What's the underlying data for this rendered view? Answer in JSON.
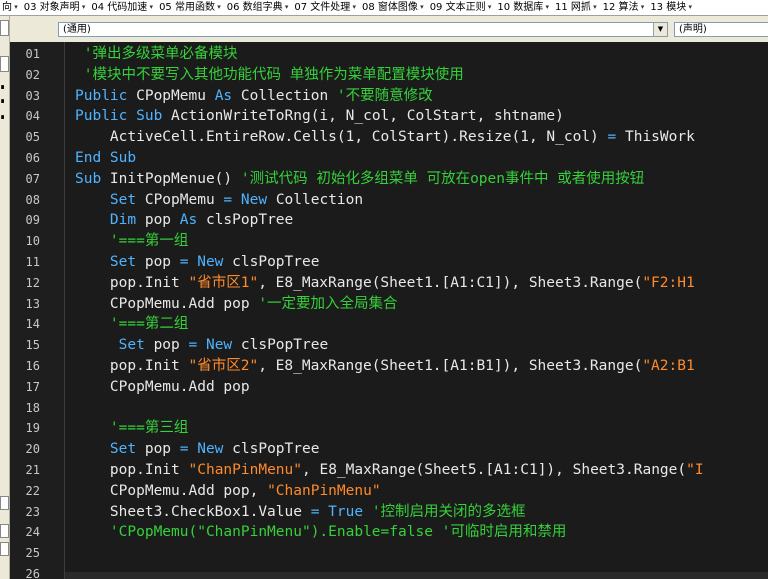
{
  "menubar": {
    "items": [
      {
        "label": "向",
        "arrow": "▾"
      },
      {
        "label": "03 对象声明",
        "arrow": "▾"
      },
      {
        "label": "04 代码加速",
        "arrow": "▾"
      },
      {
        "label": "05 常用函数",
        "arrow": "▾"
      },
      {
        "label": "06 数组字典",
        "arrow": "▾"
      },
      {
        "label": "07 文件处理",
        "arrow": "▾"
      },
      {
        "label": "08 窗体图像",
        "arrow": "▾"
      },
      {
        "label": "09 文本正则",
        "arrow": "▾"
      },
      {
        "label": "10 数据库",
        "arrow": "▾"
      },
      {
        "label": "11 网抓",
        "arrow": "▾"
      },
      {
        "label": "12 算法",
        "arrow": "▾"
      },
      {
        "label": "13 模块",
        "arrow": "▾"
      }
    ]
  },
  "combos": {
    "object": "(通用)",
    "procedure": "(声明)",
    "dropdown_glyph": "▼"
  },
  "editor": {
    "line_numbers": [
      "01",
      "02",
      "03",
      "04",
      "05",
      "06",
      "07",
      "08",
      "09",
      "10",
      "11",
      "12",
      "13",
      "14",
      "15",
      "16",
      "17",
      "18",
      "19",
      "20",
      "21",
      "22",
      "23",
      "24",
      "25",
      "26"
    ],
    "lines": [
      [
        {
          "t": " ",
          "c": ""
        },
        {
          "t": "'弹出多级菜单必备模块",
          "c": "cm"
        }
      ],
      [
        {
          "t": " ",
          "c": ""
        },
        {
          "t": "'模块中不要写入其他功能代码 单独作为菜单配置模块使用",
          "c": "cm"
        }
      ],
      [
        {
          "t": "Public ",
          "c": "kw"
        },
        {
          "t": "CPopMemu ",
          "c": ""
        },
        {
          "t": "As ",
          "c": "kw"
        },
        {
          "t": "Collection ",
          "c": ""
        },
        {
          "t": "'不要随意修改",
          "c": "cm"
        }
      ],
      [
        {
          "t": "Public Sub ",
          "c": "kw"
        },
        {
          "t": "ActionWriteToRng(i, N_col, ColStart, shtname)",
          "c": ""
        }
      ],
      [
        {
          "t": "    ActiveCell.EntireRow.Cells(1, ColStart).Resize(1, N_col) ",
          "c": ""
        },
        {
          "t": "=",
          "c": "op"
        },
        {
          "t": " ThisWork",
          "c": ""
        }
      ],
      [
        {
          "t": "End Sub",
          "c": "kw"
        }
      ],
      [
        {
          "t": "Sub ",
          "c": "kw"
        },
        {
          "t": "InitPopMenue() ",
          "c": ""
        },
        {
          "t": "'测试代码 初始化多组菜单 可放在open事件中 或者使用按钮",
          "c": "cm"
        }
      ],
      [
        {
          "t": "    Set ",
          "c": "kw"
        },
        {
          "t": "CPopMemu ",
          "c": ""
        },
        {
          "t": "= New ",
          "c": "kw"
        },
        {
          "t": "Collection",
          "c": ""
        }
      ],
      [
        {
          "t": "    Dim ",
          "c": "kw"
        },
        {
          "t": "pop ",
          "c": ""
        },
        {
          "t": "As ",
          "c": "kw"
        },
        {
          "t": "clsPopTree",
          "c": ""
        }
      ],
      [
        {
          "t": "    '===第一组",
          "c": "cm"
        }
      ],
      [
        {
          "t": "    Set ",
          "c": "kw"
        },
        {
          "t": "pop ",
          "c": ""
        },
        {
          "t": "= New ",
          "c": "kw"
        },
        {
          "t": "clsPopTree",
          "c": ""
        }
      ],
      [
        {
          "t": "    pop.Init ",
          "c": ""
        },
        {
          "t": "\"省市区1\"",
          "c": "st"
        },
        {
          "t": ", E8_MaxRange(Sheet1.[A1:C1]), Sheet3.Range(",
          "c": ""
        },
        {
          "t": "\"F2:H1",
          "c": "st"
        }
      ],
      [
        {
          "t": "    CPopMemu.Add pop ",
          "c": ""
        },
        {
          "t": "'一定要加入全局集合",
          "c": "cm"
        }
      ],
      [
        {
          "t": "    '===第二组",
          "c": "cm"
        }
      ],
      [
        {
          "t": "     Set ",
          "c": "kw"
        },
        {
          "t": "pop ",
          "c": ""
        },
        {
          "t": "= New ",
          "c": "kw"
        },
        {
          "t": "clsPopTree",
          "c": ""
        }
      ],
      [
        {
          "t": "    pop.Init ",
          "c": ""
        },
        {
          "t": "\"省市区2\"",
          "c": "st"
        },
        {
          "t": ", E8_MaxRange(Sheet1.[A1:B1]), Sheet3.Range(",
          "c": ""
        },
        {
          "t": "\"A2:B1",
          "c": "st"
        }
      ],
      [
        {
          "t": "    CPopMemu.Add pop",
          "c": ""
        }
      ],
      [
        {
          "t": "",
          "c": ""
        }
      ],
      [
        {
          "t": "    '===第三组",
          "c": "cm"
        }
      ],
      [
        {
          "t": "    Set ",
          "c": "kw"
        },
        {
          "t": "pop ",
          "c": ""
        },
        {
          "t": "= New ",
          "c": "kw"
        },
        {
          "t": "clsPopTree",
          "c": ""
        }
      ],
      [
        {
          "t": "    pop.Init ",
          "c": ""
        },
        {
          "t": "\"ChanPinMenu\"",
          "c": "st"
        },
        {
          "t": ", E8_MaxRange(Sheet5.[A1:C1]), Sheet3.Range(",
          "c": ""
        },
        {
          "t": "\"I",
          "c": "st"
        }
      ],
      [
        {
          "t": "    CPopMemu.Add pop, ",
          "c": ""
        },
        {
          "t": "\"ChanPinMenu\"",
          "c": "st"
        }
      ],
      [
        {
          "t": "    Sheet3.CheckBox1.Value ",
          "c": ""
        },
        {
          "t": "= True ",
          "c": "kw"
        },
        {
          "t": "'控制启用关闭的多选框",
          "c": "cm"
        }
      ],
      [
        {
          "t": "    'CPopMemu(\"ChanPinMenu\").Enable=false '可临时启用和禁用",
          "c": "cm"
        }
      ],
      [
        {
          "t": "",
          "c": ""
        }
      ],
      [
        {
          "t": "",
          "c": ""
        }
      ]
    ]
  },
  "colors": {
    "keyword": "#4fb3ff",
    "comment": "#35d13a",
    "string": "#ff8a2b",
    "text": "#e8e8e8",
    "background": "#1b1b1b"
  }
}
